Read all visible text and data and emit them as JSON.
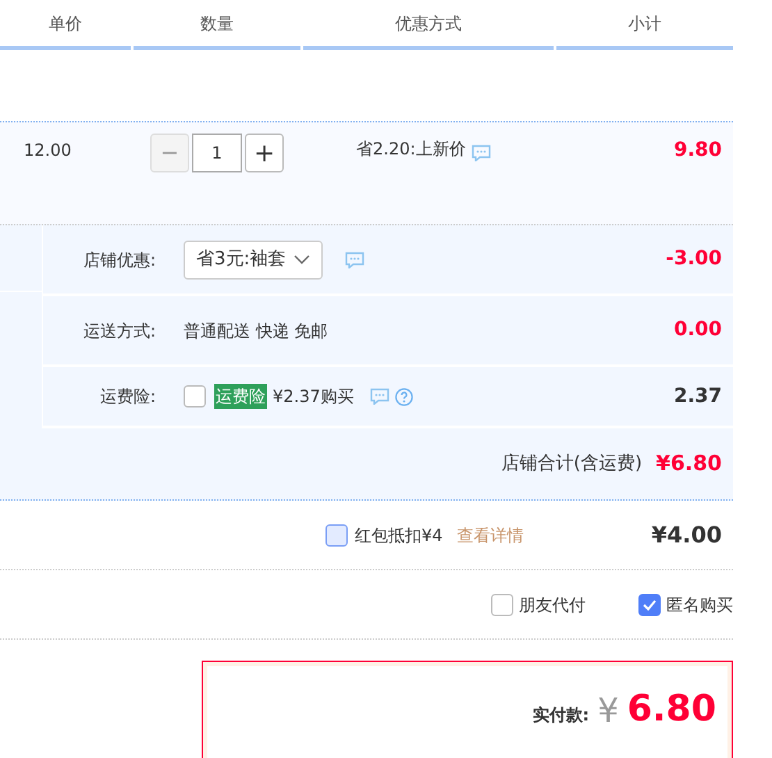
{
  "columns": [
    {
      "label": "单价"
    },
    {
      "label": "数量"
    },
    {
      "label": "优惠方式"
    },
    {
      "label": "小计"
    }
  ],
  "item": {
    "price": "12.00",
    "decrease_symbol": "−",
    "decrease_disabled": true,
    "quantity": "1",
    "increase_symbol": "+",
    "promo": "省2.20:上新价",
    "subtotal": "9.80"
  },
  "shop_rows": [
    {
      "kind": "select",
      "label": "店铺优惠:",
      "value": "省3元:袖套",
      "amount": "-3.00",
      "color": "#ff0036"
    },
    {
      "kind": "text",
      "label": "运送方式:",
      "value": "普通配送 快递 免邮",
      "amount": "0.00",
      "color": "#ff0036"
    },
    {
      "kind": "insurance",
      "label": "运费险:",
      "checked": false,
      "tag": "运费险",
      "value": "¥2.37购买",
      "amount": "2.37",
      "color": "#333333"
    }
  ],
  "shop_total": {
    "label": "店铺合计(含运费)",
    "amount": "¥6.80"
  },
  "red_packet": {
    "checked": false,
    "label": "红包抵扣¥4",
    "link": "查看详情",
    "amount": "¥4.00"
  },
  "options": [
    {
      "label": "朋友代付",
      "checked": false
    },
    {
      "label": "匿名购买",
      "checked": true
    }
  ],
  "payment": {
    "label": "实付款:",
    "currency": "¥",
    "amount": "6.80"
  }
}
